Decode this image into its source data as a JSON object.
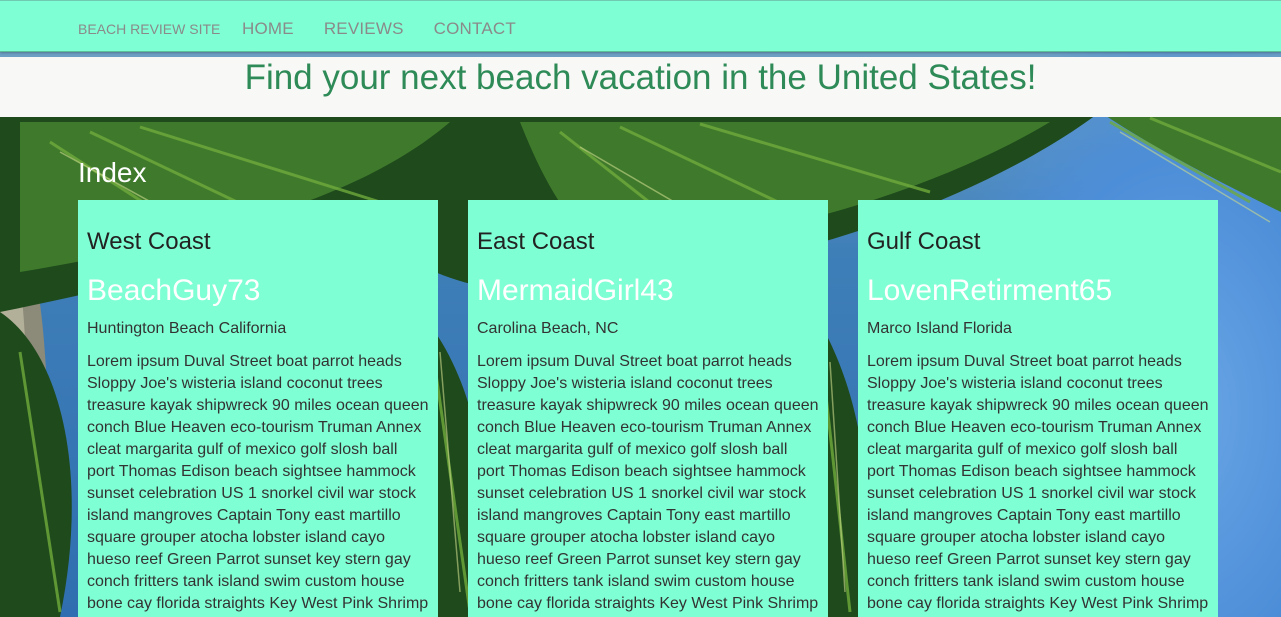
{
  "nav": {
    "brand": "BEACH REVIEW SITE",
    "links": [
      "HOME",
      "REVIEWS",
      "CONTACT"
    ]
  },
  "hero": {
    "title": "Find your next beach vacation in the United States!"
  },
  "section": {
    "title": "Index"
  },
  "cards": [
    {
      "region": "West Coast",
      "user": "BeachGuy73",
      "place": "Huntington Beach California",
      "text": "Lorem ipsum Duval Street boat parrot heads Sloppy Joe's wisteria island coconut trees treasure kayak shipwreck 90 miles ocean queen conch Blue Heaven eco-tourism Truman Annex cleat margarita gulf of mexico golf slosh ball port Thomas Edison beach sightsee hammock sunset celebration US 1 snorkel civil war stock island mangroves Captain Tony east martillo square grouper atocha lobster island cayo hueso reef Green Parrot sunset key stern gay conch fritters tank island swim custom house bone cay florida straights Key West Pink Shrimp"
    },
    {
      "region": "East Coast",
      "user": "MermaidGirl43",
      "place": "Carolina Beach, NC",
      "text": "Lorem ipsum Duval Street boat parrot heads Sloppy Joe's wisteria island coconut trees treasure kayak shipwreck 90 miles ocean queen conch Blue Heaven eco-tourism Truman Annex cleat margarita gulf of mexico golf slosh ball port Thomas Edison beach sightsee hammock sunset celebration US 1 snorkel civil war stock island mangroves Captain Tony east martillo square grouper atocha lobster island cayo hueso reef Green Parrot sunset key stern gay conch fritters tank island swim custom house bone cay florida straights Key West Pink Shrimp"
    },
    {
      "region": "Gulf Coast",
      "user": "LovenRetirment65",
      "place": "Marco Island Florida",
      "text": "Lorem ipsum Duval Street boat parrot heads Sloppy Joe's wisteria island coconut trees treasure kayak shipwreck 90 miles ocean queen conch Blue Heaven eco-tourism Truman Annex cleat margarita gulf of mexico golf slosh ball port Thomas Edison beach sightsee hammock sunset celebration US 1 snorkel civil war stock island mangroves Captain Tony east martillo square grouper atocha lobster island cayo hueso reef Green Parrot sunset key stern gay conch fritters tank island swim custom house bone cay florida straights Key West Pink Shrimp"
    }
  ],
  "colors": {
    "nav_bg": "#7fffd4",
    "card_bg": "#7fffd4",
    "hero_title": "#2e8b57",
    "username": "#ffffff"
  },
  "background_image": "palm-tree-sky-photo"
}
